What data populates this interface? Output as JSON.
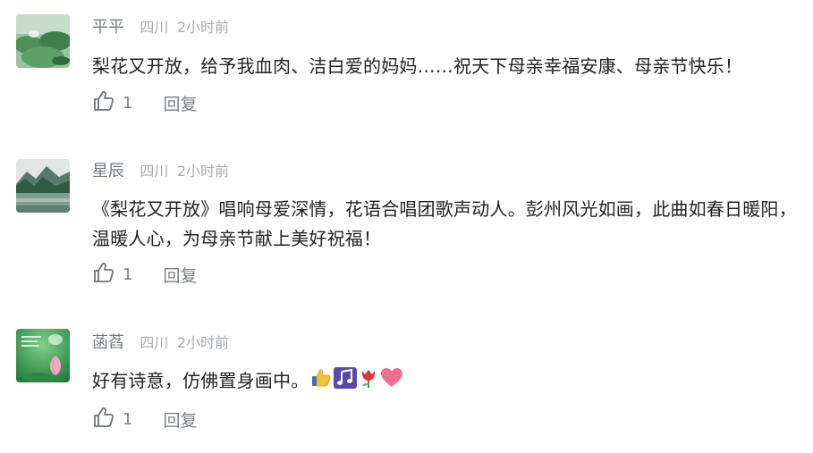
{
  "comments": [
    {
      "username": "平平",
      "location": "四川",
      "time": "2小时前",
      "text": "梨花又开放，给予我血肉、洁白爱的妈妈……祝天下母亲幸福安康、母亲节快乐！",
      "likes": "1",
      "reply_label": "回复",
      "avatar_icon": "lotus-pond-avatar-icon"
    },
    {
      "username": "星辰",
      "location": "四川",
      "time": "2小时前",
      "text": "《梨花又开放》唱响母爱深情，花语合唱团歌声动人。彭州风光如画，此曲如春日暖阳，温暖人心，为母亲节献上美好祝福！",
      "likes": "1",
      "reply_label": "回复",
      "avatar_icon": "mountain-lake-avatar-icon"
    },
    {
      "username": "菡萏",
      "location": "四川",
      "time": "2小时前",
      "text": "好有诗意，仿佛置身画中。",
      "emojis": [
        "thumbs-up-icon",
        "music-notes-icon",
        "tulip-icon",
        "heart-icon"
      ],
      "likes": "1",
      "reply_label": "回复",
      "avatar_icon": "lotus-bud-avatar-icon"
    }
  ]
}
